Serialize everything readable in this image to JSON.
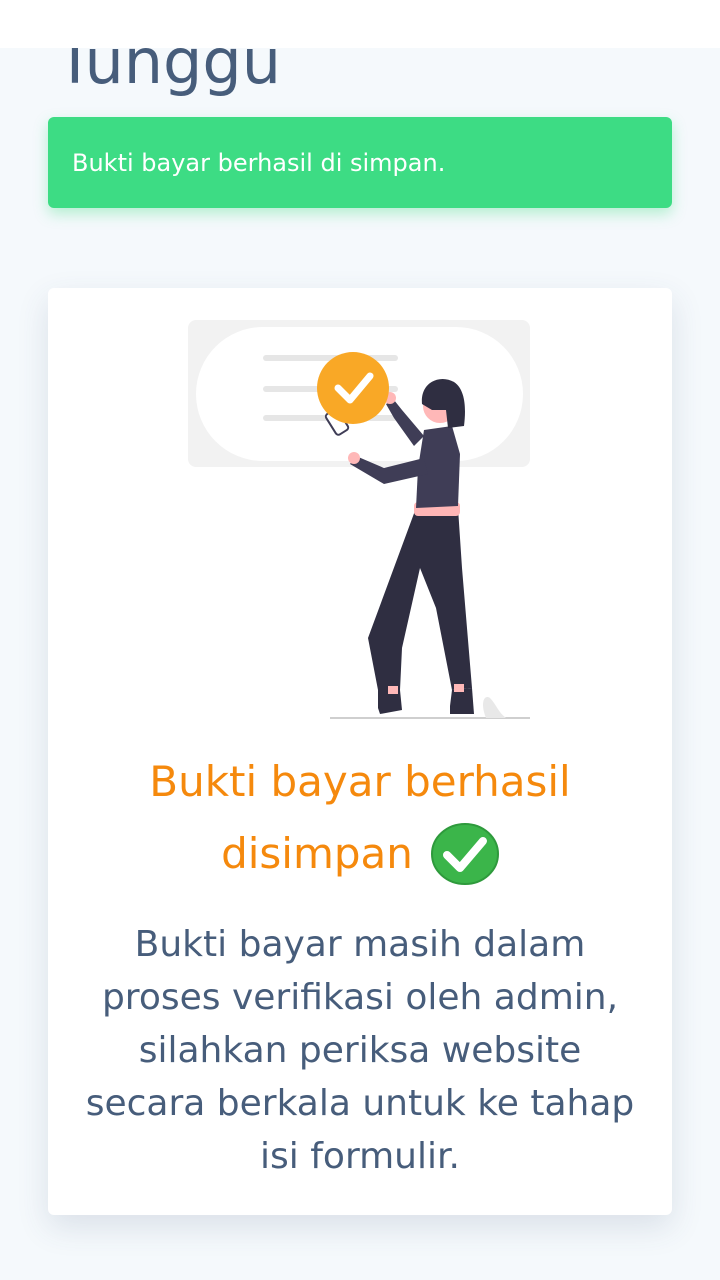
{
  "page": {
    "heading": "Tunggu"
  },
  "alert": {
    "message": "Bukti bayar berhasil di simpan."
  },
  "card": {
    "title_line1": "Bukti bayar berhasil",
    "title_line2": "disimpan",
    "body_lines": [
      "Bukti bayar masih dalam",
      "proses verifikasi oleh admin,",
      "silahkan periksa website",
      "secara berkala untuk ke tahap",
      "isi formulir."
    ]
  },
  "colors": {
    "background": "#f5f9fc",
    "alert_bg": "#3ddc84",
    "title": "#f5890d",
    "body_text": "#475d7b",
    "check_badge": "#3bb54a",
    "illustration_accent": "#f9a826"
  },
  "icons": {
    "illustration": "woman-approving-checkmark-illustration",
    "title_badge": "green-check-circle-icon"
  }
}
